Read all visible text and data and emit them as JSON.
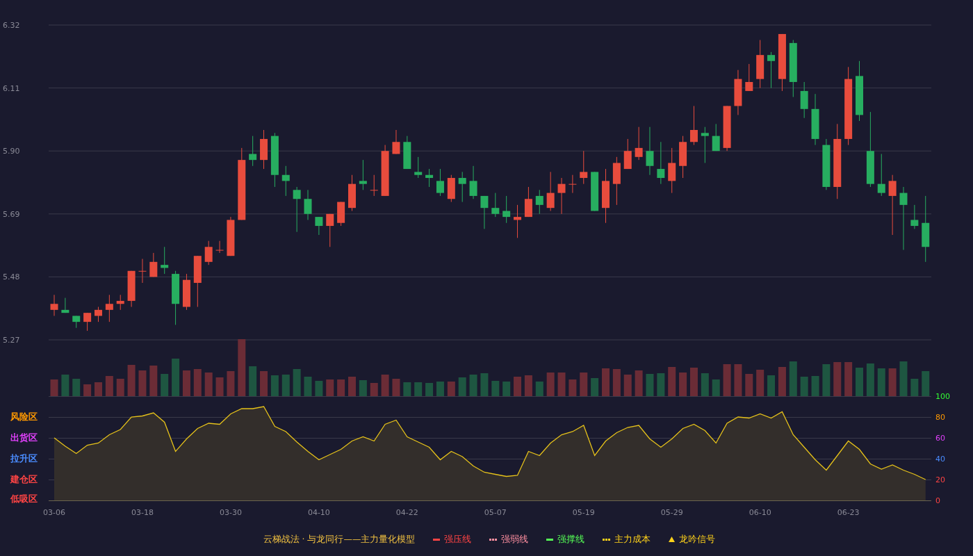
{
  "price_chart": {
    "chart_data": {
      "type": "candlestick",
      "grid": true,
      "ylim": [
        5.27,
        6.32
      ],
      "yticks": [
        {
          "value": 6.32,
          "label": "6.32"
        },
        {
          "value": 6.11,
          "label": "6.11"
        },
        {
          "value": 5.9,
          "label": "5.90"
        },
        {
          "value": 5.69,
          "label": "5.69"
        },
        {
          "value": 5.48,
          "label": "5.48"
        },
        {
          "value": 5.27,
          "label": "5.27"
        }
      ],
      "ohlc": [
        [
          5.37,
          5.42,
          5.35,
          5.39
        ],
        [
          5.37,
          5.41,
          5.36,
          5.36
        ],
        [
          5.35,
          5.35,
          5.31,
          5.33
        ],
        [
          5.33,
          5.36,
          5.3,
          5.36
        ],
        [
          5.35,
          5.38,
          5.33,
          5.37
        ],
        [
          5.37,
          5.42,
          5.33,
          5.39
        ],
        [
          5.39,
          5.42,
          5.37,
          5.4
        ],
        [
          5.4,
          5.5,
          5.38,
          5.5
        ],
        [
          5.5,
          5.54,
          5.46,
          5.5
        ],
        [
          5.48,
          5.56,
          5.48,
          5.53
        ],
        [
          5.52,
          5.58,
          5.49,
          5.51
        ],
        [
          5.49,
          5.5,
          5.32,
          5.39
        ],
        [
          5.38,
          5.49,
          5.37,
          5.47
        ],
        [
          5.46,
          5.55,
          5.38,
          5.55
        ],
        [
          5.53,
          5.6,
          5.52,
          5.58
        ],
        [
          5.57,
          5.6,
          5.56,
          5.57
        ],
        [
          5.55,
          5.68,
          5.55,
          5.67
        ],
        [
          5.67,
          5.91,
          5.67,
          5.87
        ],
        [
          5.89,
          5.95,
          5.85,
          5.87
        ],
        [
          5.87,
          5.97,
          5.84,
          5.94
        ],
        [
          5.95,
          5.96,
          5.78,
          5.82
        ],
        [
          5.82,
          5.85,
          5.75,
          5.8
        ],
        [
          5.77,
          5.78,
          5.63,
          5.74
        ],
        [
          5.74,
          5.77,
          5.67,
          5.69
        ],
        [
          5.68,
          5.68,
          5.62,
          5.65
        ],
        [
          5.65,
          5.69,
          5.58,
          5.69
        ],
        [
          5.66,
          5.73,
          5.65,
          5.73
        ],
        [
          5.71,
          5.82,
          5.7,
          5.79
        ],
        [
          5.8,
          5.87,
          5.77,
          5.79
        ],
        [
          5.77,
          5.82,
          5.75,
          5.77
        ],
        [
          5.75,
          5.92,
          5.75,
          5.9
        ],
        [
          5.89,
          5.97,
          5.89,
          5.93
        ],
        [
          5.93,
          5.95,
          5.84,
          5.84
        ],
        [
          5.83,
          5.88,
          5.81,
          5.82
        ],
        [
          5.82,
          5.84,
          5.78,
          5.81
        ],
        [
          5.8,
          5.84,
          5.75,
          5.76
        ],
        [
          5.74,
          5.82,
          5.73,
          5.81
        ],
        [
          5.81,
          5.83,
          5.73,
          5.79
        ],
        [
          5.8,
          5.85,
          5.74,
          5.75
        ],
        [
          5.75,
          5.75,
          5.64,
          5.71
        ],
        [
          5.71,
          5.76,
          5.68,
          5.69
        ],
        [
          5.7,
          5.75,
          5.66,
          5.68
        ],
        [
          5.67,
          5.72,
          5.61,
          5.68
        ],
        [
          5.68,
          5.78,
          5.68,
          5.74
        ],
        [
          5.75,
          5.77,
          5.69,
          5.72
        ],
        [
          5.71,
          5.83,
          5.7,
          5.76
        ],
        [
          5.76,
          5.81,
          5.69,
          5.79
        ],
        [
          5.79,
          5.82,
          5.76,
          5.79
        ],
        [
          5.81,
          5.9,
          5.79,
          5.83
        ],
        [
          5.83,
          5.83,
          5.7,
          5.7
        ],
        [
          5.71,
          5.84,
          5.66,
          5.8
        ],
        [
          5.79,
          5.88,
          5.72,
          5.86
        ],
        [
          5.84,
          5.94,
          5.84,
          5.9
        ],
        [
          5.88,
          5.98,
          5.87,
          5.91
        ],
        [
          5.9,
          5.98,
          5.82,
          5.85
        ],
        [
          5.84,
          5.93,
          5.79,
          5.81
        ],
        [
          5.8,
          5.91,
          5.76,
          5.86
        ],
        [
          5.85,
          5.95,
          5.81,
          5.93
        ],
        [
          5.93,
          6.05,
          5.92,
          5.97
        ],
        [
          5.96,
          5.98,
          5.86,
          5.95
        ],
        [
          5.95,
          5.99,
          5.9,
          5.9
        ],
        [
          5.91,
          6.05,
          5.9,
          6.05
        ],
        [
          6.05,
          6.17,
          6.02,
          6.14
        ],
        [
          6.1,
          6.19,
          6.1,
          6.13
        ],
        [
          6.14,
          6.27,
          6.11,
          6.22
        ],
        [
          6.22,
          6.23,
          6.11,
          6.2
        ],
        [
          6.14,
          6.29,
          6.1,
          6.29
        ],
        [
          6.26,
          6.27,
          6.08,
          6.13
        ],
        [
          6.1,
          6.13,
          6.01,
          6.04
        ],
        [
          6.04,
          6.09,
          5.92,
          5.94
        ],
        [
          5.92,
          5.94,
          5.77,
          5.78
        ],
        [
          5.78,
          5.99,
          5.74,
          5.94
        ],
        [
          5.94,
          6.18,
          5.92,
          6.14
        ],
        [
          6.15,
          6.2,
          6.0,
          6.02
        ],
        [
          5.9,
          6.03,
          5.78,
          5.79
        ],
        [
          5.79,
          5.89,
          5.75,
          5.76
        ],
        [
          5.75,
          5.82,
          5.62,
          5.8
        ],
        [
          5.76,
          5.78,
          5.57,
          5.72
        ],
        [
          5.67,
          5.72,
          5.64,
          5.65
        ],
        [
          5.66,
          5.75,
          5.53,
          5.58
        ]
      ]
    }
  },
  "oscillator": {
    "zones": [
      {
        "label": "风险区",
        "color": "#ff9900"
      },
      {
        "label": "出货区",
        "color": "#e040fb"
      },
      {
        "label": "拉升区",
        "color": "#4a8cff"
      },
      {
        "label": "建仓区",
        "color": "#ff4444"
      },
      {
        "label": "低吸区",
        "color": "#ff4444"
      }
    ],
    "axis_colors": [
      {
        "color": "#33ff33"
      },
      {
        "color": "#ff9900"
      },
      {
        "color": "#e040fb"
      },
      {
        "color": "#4a8cff"
      },
      {
        "color": "#ff4444"
      },
      {
        "color": "#ff4444"
      }
    ],
    "chart_data": {
      "type": "area",
      "grid": true,
      "ylim": [
        0,
        100
      ],
      "yticks": [
        100,
        80,
        60,
        40,
        20,
        0
      ],
      "categories": [
        "03-06",
        null,
        null,
        null,
        null,
        null,
        null,
        null,
        "03-18",
        null,
        null,
        null,
        null,
        null,
        null,
        null,
        "03-30",
        null,
        null,
        null,
        null,
        null,
        null,
        null,
        "04-10",
        null,
        null,
        null,
        null,
        null,
        null,
        null,
        "04-22",
        null,
        null,
        null,
        null,
        null,
        null,
        null,
        "05-07",
        null,
        null,
        null,
        null,
        null,
        null,
        null,
        "05-19",
        null,
        null,
        null,
        null,
        null,
        null,
        null,
        "05-29",
        null,
        null,
        null,
        null,
        null,
        null,
        null,
        "06-10",
        null,
        null,
        null,
        null,
        null,
        null,
        null,
        "06-23",
        null,
        null,
        null,
        null,
        null,
        null,
        null
      ],
      "series": [
        {
          "color": "#e6c21a",
          "values": [
            60,
            52,
            45,
            53,
            55,
            63,
            68,
            80,
            81,
            84,
            75,
            47,
            59,
            69,
            74,
            73,
            83,
            88,
            88,
            90,
            71,
            66,
            56,
            47,
            39,
            44,
            49,
            57,
            61,
            57,
            73,
            77,
            61,
            56,
            51,
            39,
            47,
            42,
            33,
            27,
            25,
            23,
            24,
            47,
            43,
            55,
            63,
            66,
            72,
            43,
            57,
            65,
            70,
            72,
            59,
            51,
            59,
            69,
            73,
            67,
            55,
            74,
            80,
            79,
            83,
            79,
            85,
            63,
            51,
            39,
            29,
            43,
            57,
            49,
            35,
            30,
            34,
            29,
            25,
            20
          ]
        }
      ]
    }
  },
  "legend": {
    "title": "云梯战法 · 与龙同行——主力量化模型",
    "items": [
      {
        "label": "强压线",
        "kind": "solid",
        "color": "#ff4444"
      },
      {
        "label": "强弱线",
        "kind": "dashed",
        "color": "#ff8fa0"
      },
      {
        "label": "强撑线",
        "kind": "solid",
        "color": "#55ff55"
      },
      {
        "label": "主力成本",
        "kind": "dashed",
        "color": "#ffd21a"
      },
      {
        "label": "龙吟信号",
        "kind": "triangle",
        "color": "#ffd21a"
      }
    ]
  }
}
